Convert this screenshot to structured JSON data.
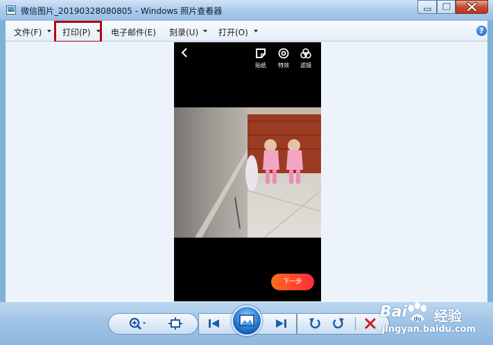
{
  "window": {
    "title": "微信图片_20190328080805 - Windows 照片查看器"
  },
  "menu": {
    "file": "文件(F)",
    "print": "打印(P)",
    "email": "电子邮件(E)",
    "burn": "刻录(U)",
    "open": "打开(O)",
    "help": "?"
  },
  "image": {
    "tools": [
      {
        "label": "贴纸",
        "icon": "sticker-icon"
      },
      {
        "label": "特效",
        "icon": "effects-icon"
      },
      {
        "label": "滤镜",
        "icon": "filter-icon"
      }
    ],
    "next_button": "下一步"
  },
  "watermark": {
    "brand": "Bai",
    "brand_suffix": "经验",
    "url": "jingyan.baidu.com"
  },
  "colors": {
    "highlight": "#b4000d",
    "next_button_start": "#ff6d1a",
    "next_button_end": "#ff2b3a"
  }
}
